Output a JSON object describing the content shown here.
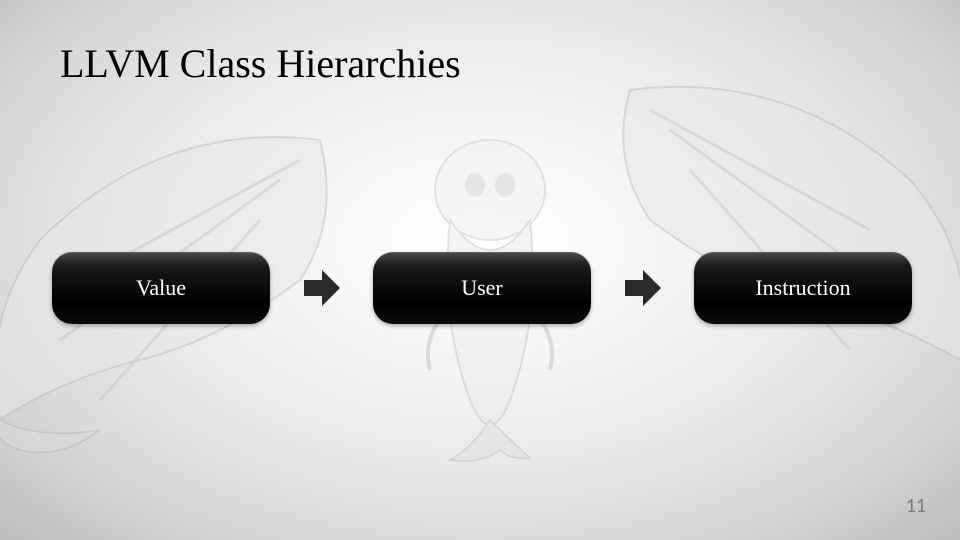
{
  "title": "LLVM Class Hierarchies",
  "nodes": {
    "value": "Value",
    "user": "User",
    "instruction": "Instruction"
  },
  "page_number": "11"
}
